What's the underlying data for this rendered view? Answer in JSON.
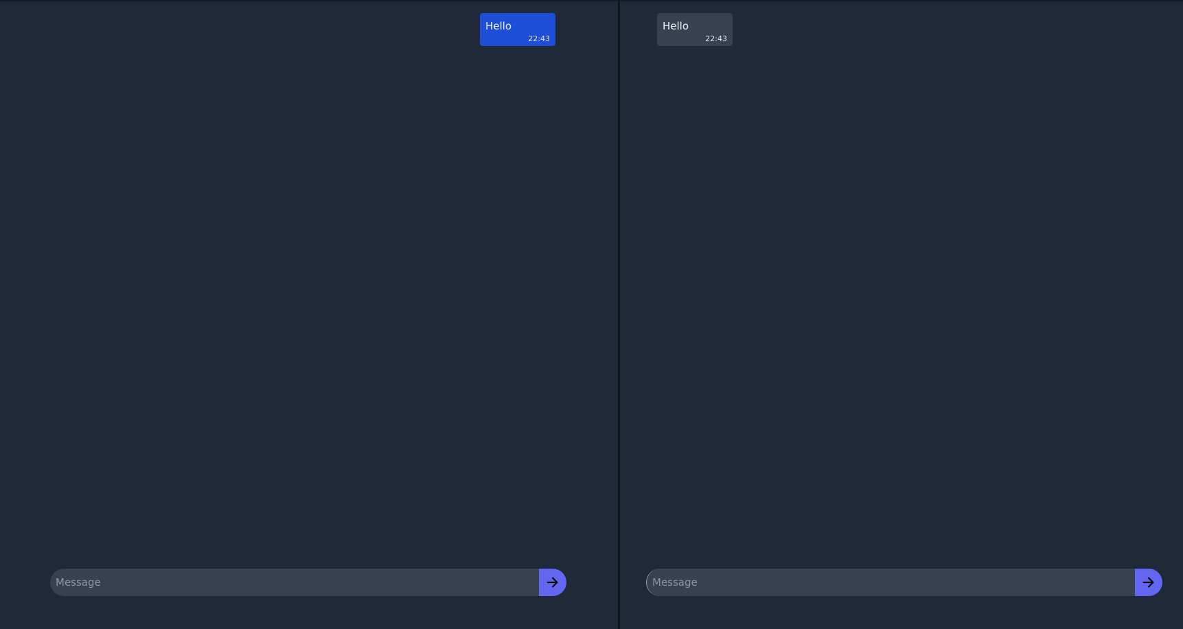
{
  "left_chat": {
    "messages": [
      {
        "text": "Hello",
        "time": "22:43",
        "direction": "sent"
      }
    ],
    "input": {
      "value": "",
      "placeholder": "Message"
    },
    "send_icon": "arrow-right-icon"
  },
  "right_chat": {
    "messages": [
      {
        "text": "Hello",
        "time": "22:43",
        "direction": "received"
      }
    ],
    "input": {
      "value": "",
      "placeholder": "Message"
    },
    "send_icon": "arrow-right-icon"
  },
  "colors": {
    "background": "#1f2937",
    "sent_bubble": "#1d4ed8",
    "received_bubble": "#374151",
    "input_background": "#374151",
    "send_button": "#6366f1"
  }
}
